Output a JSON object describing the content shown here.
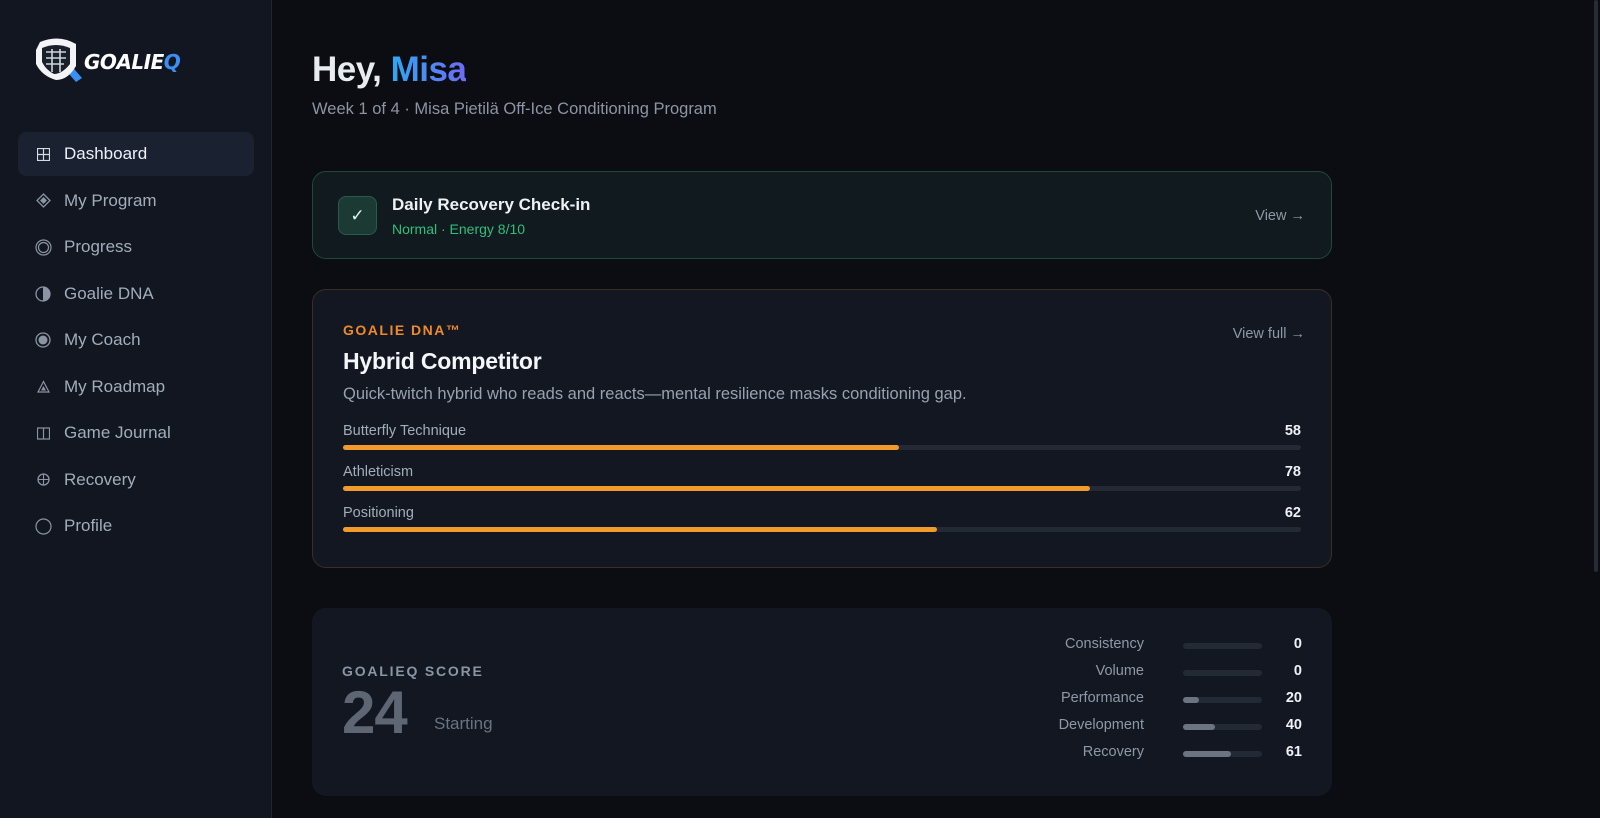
{
  "brand": {
    "name_main": "GOALIE",
    "name_accent": "Q"
  },
  "sidebar": {
    "items": [
      {
        "label": "Dashboard",
        "icon": "grid-icon",
        "active": true
      },
      {
        "label": "My Program",
        "icon": "diamond-icon"
      },
      {
        "label": "Progress",
        "icon": "ring-icon"
      },
      {
        "label": "Goalie DNA",
        "icon": "half-circle-icon"
      },
      {
        "label": "My Coach",
        "icon": "target-icon"
      },
      {
        "label": "My Roadmap",
        "icon": "triangle-icon"
      },
      {
        "label": "Game Journal",
        "icon": "journal-icon"
      },
      {
        "label": "Recovery",
        "icon": "recovery-icon"
      },
      {
        "label": "Profile",
        "icon": "profile-icon"
      }
    ]
  },
  "header": {
    "greeting": "Hey,",
    "name": "Misa",
    "subtitle": "Week 1 of 4 · Misa Pietilä Off-Ice Conditioning Program"
  },
  "checkin": {
    "title": "Daily Recovery Check-in",
    "status": "Normal · Energy 8/10",
    "link": "View →"
  },
  "dna": {
    "label": "GOALIE DNA™",
    "link": "View full →",
    "title": "Hybrid Competitor",
    "description": "Quick-twitch hybrid who reads and reacts—mental resilience masks conditioning gap.",
    "traits": [
      {
        "name": "Butterfly Technique",
        "value": "58"
      },
      {
        "name": "Athleticism",
        "value": "78"
      },
      {
        "name": "Positioning",
        "value": "62"
      }
    ]
  },
  "score": {
    "label": "GOALIEQ SCORE",
    "value": "24",
    "status": "Starting",
    "metrics": [
      {
        "name": "Consistency",
        "value": "0"
      },
      {
        "name": "Volume",
        "value": "0"
      },
      {
        "name": "Performance",
        "value": "20"
      },
      {
        "name": "Development",
        "value": "40"
      },
      {
        "name": "Recovery",
        "value": "61"
      }
    ]
  },
  "colors": {
    "accent_orange": "#f39a2c",
    "success_green": "#2fbf7d",
    "brand_blue": "#3b8ff0"
  }
}
